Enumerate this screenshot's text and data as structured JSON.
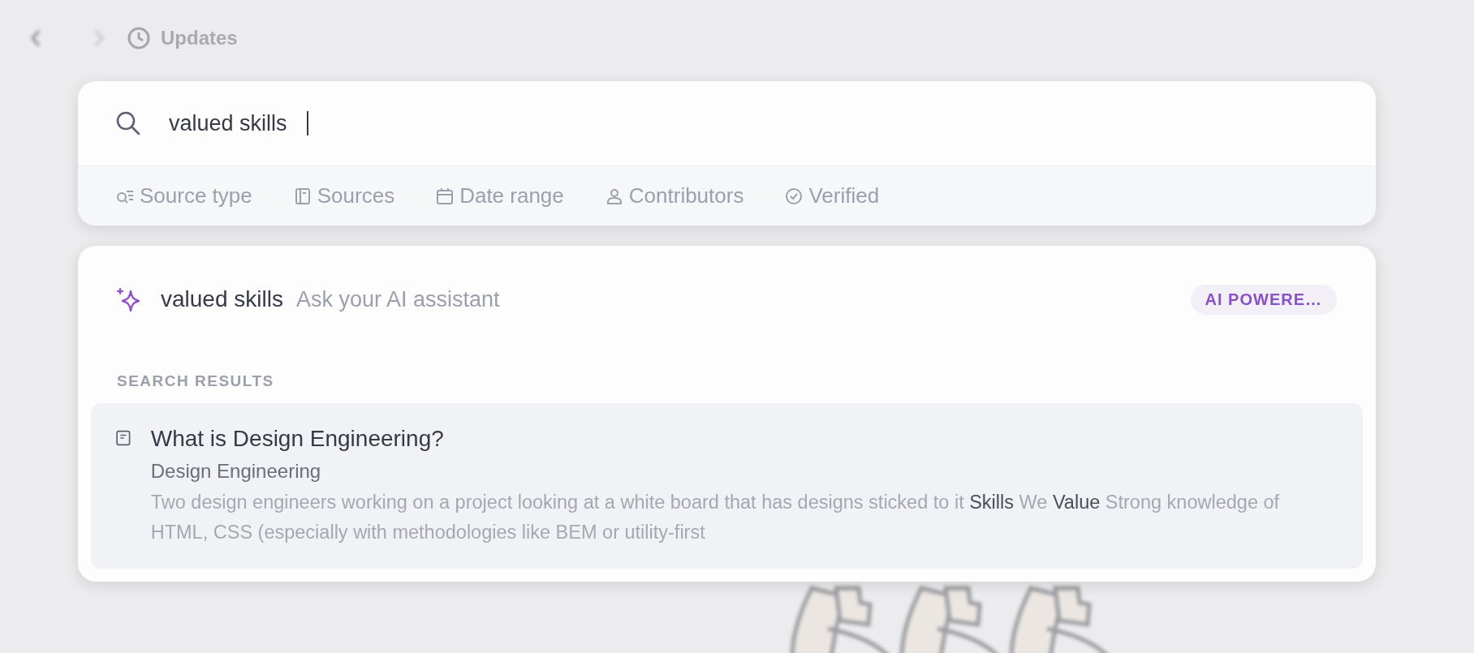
{
  "background": {
    "breadcrumb": "Updates"
  },
  "search": {
    "value": "valued skills",
    "filters": [
      {
        "kind": "source-type",
        "label": "Source type"
      },
      {
        "kind": "sources",
        "label": "Sources"
      },
      {
        "kind": "date",
        "label": "Date range"
      },
      {
        "kind": "contributors",
        "label": "Contributors"
      },
      {
        "kind": "verified",
        "label": "Verified"
      }
    ]
  },
  "ai_row": {
    "query": "valued skills",
    "hint": "Ask your AI assistant",
    "badge": "AI POWERE…"
  },
  "results": {
    "heading": "SEARCH RESULTS",
    "items": [
      {
        "title": "What is Design Engineering?",
        "source": "Design Engineering",
        "snippet": "Two design engineers working on a project looking at a white board that has designs sticked to it **Skills** We **Value** Strong knowledge of HTML, CSS (especially with methodologies like BEM or utility-first",
        "selected": true
      }
    ]
  }
}
